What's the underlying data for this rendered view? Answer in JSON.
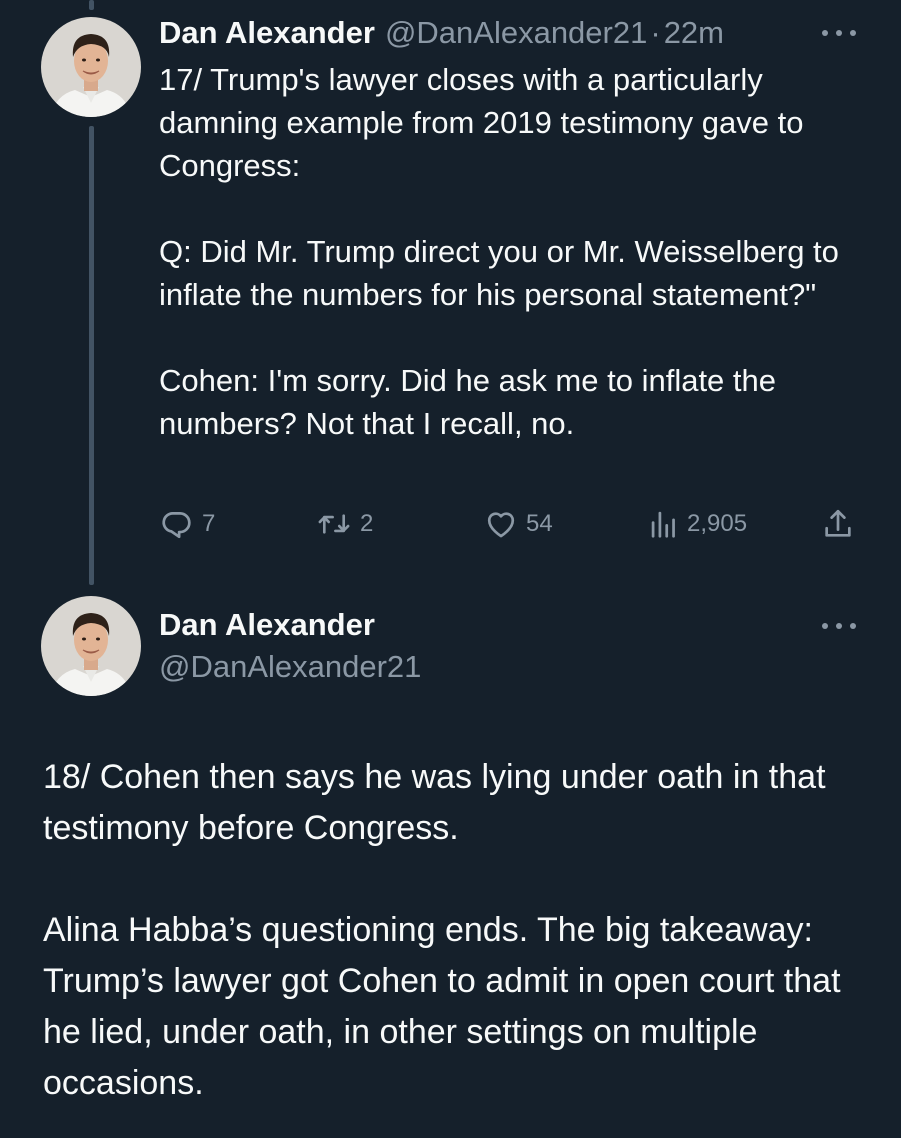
{
  "tweets": [
    {
      "author_name": "Dan Alexander",
      "author_handle": "@DanAlexander21",
      "separator": "·",
      "time": "22m",
      "paragraphs": [
        "17/ Trump's lawyer closes with a particularly damning example from 2019 testimony gave to Congress:",
        "Q: Did Mr. Trump direct you or Mr. Weisselberg to inflate the numbers for his personal statement?\"",
        "Cohen: I'm sorry. Did he ask me to inflate the numbers? Not that I recall, no."
      ],
      "actions": {
        "replies": "7",
        "retweets": "2",
        "likes": "54",
        "views": "2,905"
      }
    },
    {
      "author_name": "Dan Alexander",
      "author_handle": "@DanAlexander21",
      "paragraphs": [
        "18/ Cohen then says he was lying under oath in that testimony before Congress.",
        "Alina Habba’s questioning ends. The big takeaway: Trump’s lawyer got Cohen to admit in open court that he lied, under oath, in other settings on multiple occasions."
      ]
    }
  ],
  "icons": {
    "reply": "reply-icon",
    "retweet": "retweet-icon",
    "like": "heart-icon",
    "views": "analytics-icon",
    "share": "share-icon",
    "more": "more-icon"
  },
  "colors": {
    "background": "#15202b",
    "primary_text": "#f7f9f9",
    "secondary_text": "#8b98a5",
    "thread_line": "#425364"
  }
}
